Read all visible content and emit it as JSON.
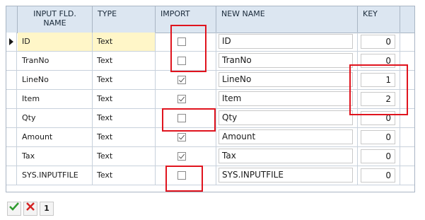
{
  "columns": {
    "input_fld_name_line1": "INPUT FLD.",
    "input_fld_name_line2": "NAME",
    "type": "TYPE",
    "import": "IMPORT",
    "new_name": "NEW NAME",
    "key": "KEY"
  },
  "rows": [
    {
      "input_name": "ID",
      "type": "Text",
      "import": false,
      "new_name": "ID",
      "key": "0",
      "selected": true
    },
    {
      "input_name": "TranNo",
      "type": "Text",
      "import": false,
      "new_name": "TranNo",
      "key": "0"
    },
    {
      "input_name": "LineNo",
      "type": "Text",
      "import": true,
      "new_name": "LineNo",
      "key": "1"
    },
    {
      "input_name": "Item",
      "type": "Text",
      "import": true,
      "new_name": "Item",
      "key": "2"
    },
    {
      "input_name": "Qty",
      "type": "Text",
      "import": false,
      "new_name": "Qty",
      "key": "0"
    },
    {
      "input_name": "Amount",
      "type": "Text",
      "import": true,
      "new_name": "Amount",
      "key": "0"
    },
    {
      "input_name": "Tax",
      "type": "Text",
      "import": true,
      "new_name": "Tax",
      "key": "0"
    },
    {
      "input_name": "SYS.INPUTFILE",
      "type": "Text",
      "import": false,
      "new_name": "SYS.INPUTFILE",
      "key": "0"
    }
  ],
  "toolbar": {
    "confirm_icon": "check-icon",
    "cancel_icon": "x-icon",
    "page_label": "1"
  },
  "colors": {
    "header_bg": "#dce6f1",
    "selected_row_bg": "#fff6c8",
    "highlight_border": "#e0141e",
    "confirm_green": "#2e9a2e",
    "cancel_red": "#d42424"
  }
}
